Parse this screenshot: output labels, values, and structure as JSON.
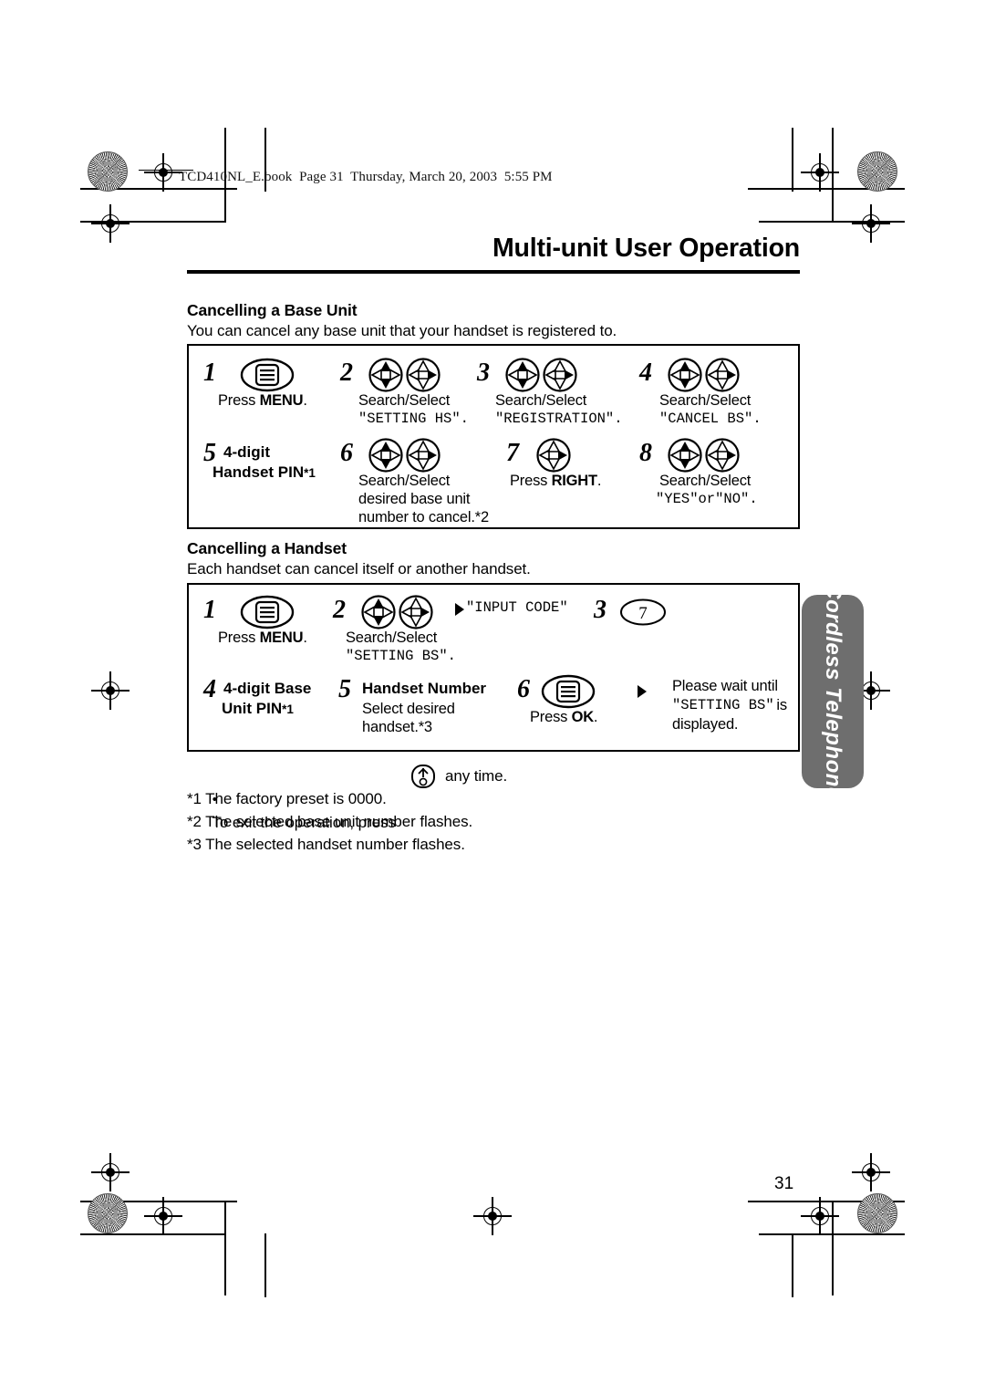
{
  "document": {
    "file_mark": "TCD410NL_E.book  Page 31  Thursday, March 20, 2003  5:55 PM",
    "running_head": "Multi-unit User Operation",
    "page_number": "31",
    "side_tab": "Cordless Telephone",
    "side_tab_color": "#6e6e6e"
  },
  "sections": [
    {
      "heading": "Cancelling a Base Unit",
      "intro": "You can cancel any base unit that your handset is registered to.",
      "steps": [
        {
          "number": "1",
          "icon": "menu-key-icon",
          "caption_prefix": "Press ",
          "caption_bold": "MENU",
          "caption_suffix": ".",
          "lcd": ""
        },
        {
          "number": "2",
          "icon": "nav-updown-leftright-icon",
          "caption_prefix": "Search/Select",
          "caption_bold": "",
          "caption_suffix": "",
          "lcd": "\"SETTING HS\"."
        },
        {
          "number": "3",
          "icon": "nav-updown-leftright-icon",
          "caption_prefix": "Search/Select",
          "caption_bold": "",
          "caption_suffix": "",
          "lcd": "\"REGISTRATION\"."
        },
        {
          "number": "4",
          "icon": "nav-updown-leftright-icon",
          "caption_prefix": "Search/Select",
          "caption_bold": "",
          "caption_suffix": "",
          "lcd": "\"CANCEL BS\"."
        },
        {
          "number": "5",
          "icon": "",
          "bold_line1": "4-digit",
          "bold_line2": "Handset PIN",
          "bold_sup": "*1"
        },
        {
          "number": "6",
          "icon": "nav-updown-leftright-icon",
          "caption_prefix": "Search/Select",
          "caption_line2": "desired base unit",
          "caption_line3": "number to cancel.*2"
        },
        {
          "number": "7",
          "icon": "nav-right-icon",
          "caption_prefix": "Press ",
          "caption_bold": "RIGHT",
          "caption_suffix": "."
        },
        {
          "number": "8",
          "icon": "nav-updown-leftright-icon",
          "caption_prefix": "Search/Select",
          "caption_bold": "",
          "caption_suffix": "",
          "lcd": "\"YES\"or\"NO\"."
        }
      ]
    },
    {
      "heading": "Cancelling a Handset",
      "intro": "Each handset can cancel itself or another handset.",
      "steps": [
        {
          "number": "1",
          "icon": "menu-key-icon",
          "caption_prefix": "Press ",
          "caption_bold": "MENU",
          "caption_suffix": "."
        },
        {
          "number": "2",
          "icon": "nav-updown-leftright-icon",
          "caption_prefix": "Search/Select",
          "lcd": "\"SETTING BS\"."
        },
        {
          "number": "",
          "icon": "flow-arrow-icon",
          "lcd": "\"INPUT CODE\""
        },
        {
          "number": "3",
          "icon": "key-7-icon",
          "key_label": "7"
        },
        {
          "number": "4",
          "icon": "",
          "bold_line1": "4-digit Base",
          "bold_line2": "Unit PIN",
          "bold_sup": "*1"
        },
        {
          "number": "5",
          "icon": "",
          "bold_line1": "Handset Number",
          "caption_line2": "Select desired",
          "caption_line3": "handset.*3"
        },
        {
          "number": "6",
          "icon": "menu-key-icon",
          "caption_prefix": "Press ",
          "caption_bold": "OK",
          "caption_suffix": "."
        },
        {
          "number": "",
          "icon": "flow-arrow-icon",
          "wait_line1": "Please wait until",
          "wait_lcd": "\"SETTING BS\"",
          "wait_line2_suffix": " is",
          "wait_line3": "displayed."
        }
      ]
    }
  ],
  "notes": {
    "bullet_prefix": "To exit the operation, press",
    "bullet_icon": "power-off-key-icon",
    "bullet_suffix": "any time.",
    "footnotes": [
      "*1 The factory preset is 0000.",
      "*2 The selected base unit number flashes.",
      "*3 The selected handset number flashes."
    ]
  }
}
